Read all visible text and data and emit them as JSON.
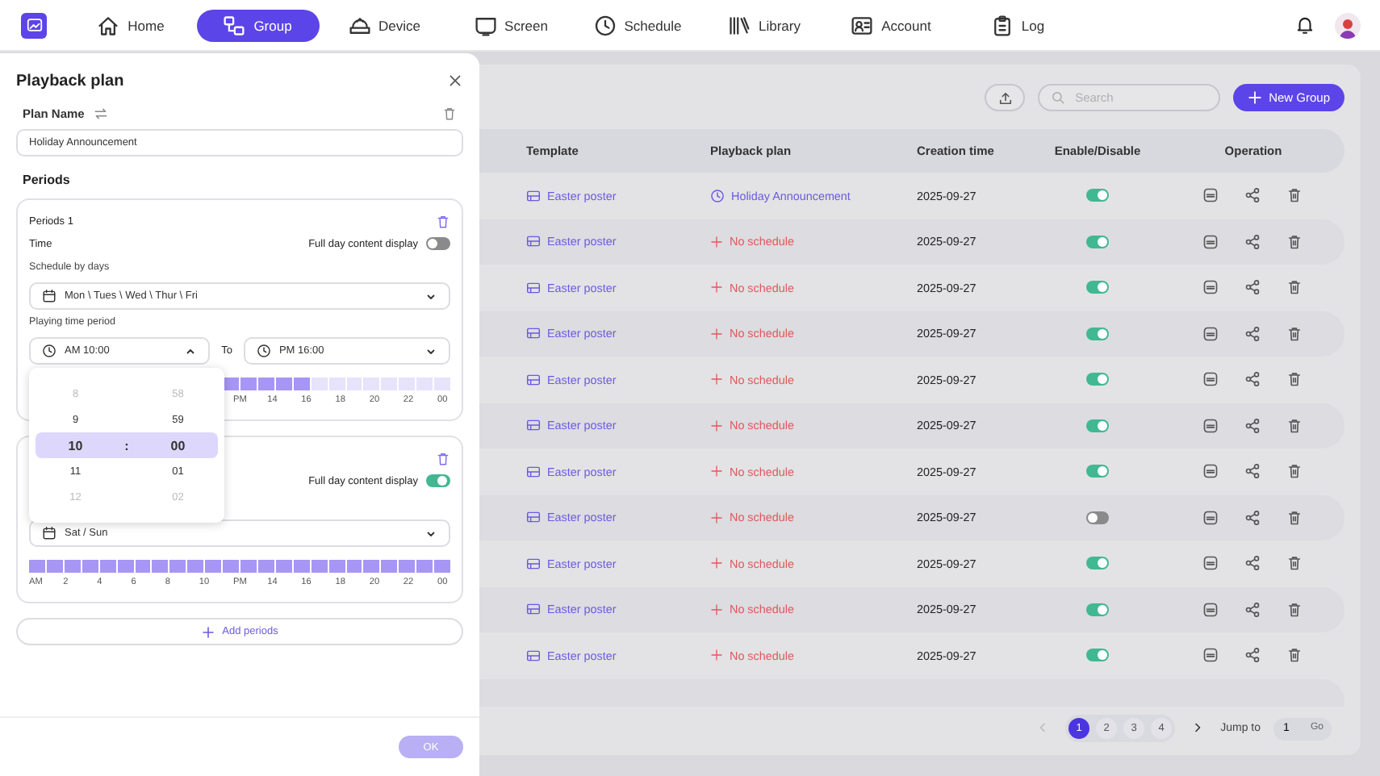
{
  "nav": {
    "items": [
      {
        "label": "Home",
        "selected": false
      },
      {
        "label": "Group",
        "selected": true
      },
      {
        "label": "Device",
        "selected": false
      },
      {
        "label": "Screen",
        "selected": false
      },
      {
        "label": "Schedule",
        "selected": false
      },
      {
        "label": "Library",
        "selected": false
      },
      {
        "label": "Account",
        "selected": false
      },
      {
        "label": "Log",
        "selected": false
      }
    ]
  },
  "toolbar": {
    "search": {
      "placeholder": "Search"
    },
    "new_button": "New Group"
  },
  "table": {
    "columns": [
      "Template",
      "Playback plan",
      "Creation time",
      "Enable/Disable",
      "Operation"
    ],
    "rows": [
      {
        "template": "Easter poster",
        "plan": "Holiday Announcement",
        "kind": "plan",
        "created": "2025-09-27",
        "enabled": true
      },
      {
        "template": "Easter poster",
        "plan": "No schedule",
        "kind": "none",
        "created": "2025-09-27",
        "enabled": true
      },
      {
        "template": "Easter poster",
        "plan": "No schedule",
        "kind": "none",
        "created": "2025-09-27",
        "enabled": true
      },
      {
        "template": "Easter poster",
        "plan": "No schedule",
        "kind": "none",
        "created": "2025-09-27",
        "enabled": true
      },
      {
        "template": "Easter poster",
        "plan": "No schedule",
        "kind": "none",
        "created": "2025-09-27",
        "enabled": true
      },
      {
        "template": "Easter poster",
        "plan": "No schedule",
        "kind": "none",
        "created": "2025-09-27",
        "enabled": true
      },
      {
        "template": "Easter poster",
        "plan": "No schedule",
        "kind": "none",
        "created": "2025-09-27",
        "enabled": true
      },
      {
        "template": "Easter poster",
        "plan": "No schedule",
        "kind": "none",
        "created": "2025-09-27",
        "enabled": false
      },
      {
        "template": "Easter poster",
        "plan": "No schedule",
        "kind": "none",
        "created": "2025-09-27",
        "enabled": true
      },
      {
        "template": "Easter poster",
        "plan": "No schedule",
        "kind": "none",
        "created": "2025-09-27",
        "enabled": true
      },
      {
        "template": "Easter poster",
        "plan": "No schedule",
        "kind": "none",
        "created": "2025-09-27",
        "enabled": true
      }
    ]
  },
  "pagination": {
    "pages": [
      {
        "label": "1",
        "selected": true
      },
      {
        "label": "2",
        "selected": false
      },
      {
        "label": "3",
        "selected": false
      },
      {
        "label": "4",
        "selected": false
      }
    ],
    "jump_label": "Jump to",
    "jump_value": "1",
    "go": "Go"
  },
  "drawer": {
    "title": "Playback plan",
    "plan_name_label": "Plan Name",
    "plan_name": "Holiday Announcement",
    "periods_label": "Periods",
    "periods": [
      {
        "title": "Periods 1",
        "time_label": "Time",
        "full_day_label": "Full day content display",
        "full_day": false,
        "days_label": "Schedule by days",
        "days": "Mon \\ Tues \\ Wed \\ Thur \\ Fri",
        "period_label": "Playing time period",
        "start": "AM 10:00",
        "start_open": true,
        "to": "To",
        "end": "PM 16:00",
        "slots": [
          true,
          true,
          true,
          true,
          true,
          false,
          false,
          false,
          false,
          false,
          false,
          false,
          false
        ],
        "axis": [
          "PM",
          "14",
          "16",
          "18",
          "20",
          "22",
          "00"
        ]
      },
      {
        "full_day_label": "Full day content display",
        "full_day": true,
        "days": "Sat / Sun",
        "axis": [
          "AM",
          "2",
          "4",
          "6",
          "8",
          "10",
          "PM",
          "14",
          "16",
          "18",
          "20",
          "22",
          "00"
        ]
      }
    ],
    "picker": [
      {
        "hour": "8",
        "minute": "58",
        "selected": false
      },
      {
        "hour": "9",
        "minute": "59",
        "selected": false
      },
      {
        "hour": "10",
        "separator": ":",
        "minute": "00",
        "selected": true
      },
      {
        "hour": "11",
        "minute": "01",
        "selected": false
      },
      {
        "hour": "12",
        "minute": "02",
        "selected": false
      }
    ],
    "add_label": "Add periods",
    "ok": "OK",
    "ok_disabled": true
  }
}
